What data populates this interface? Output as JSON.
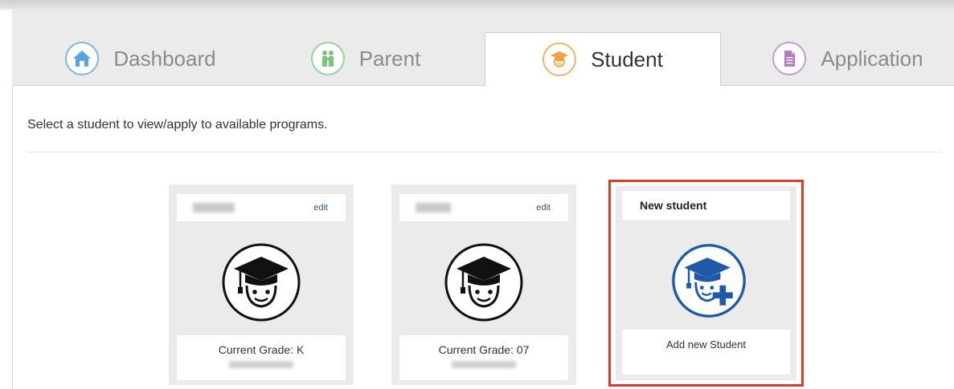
{
  "tabs": [
    {
      "label": "Dashboard",
      "icon": "home-icon",
      "color": "#5aa4e0"
    },
    {
      "label": "Parent",
      "icon": "parent-icon",
      "color": "#7cc47f"
    },
    {
      "label": "Student",
      "icon": "student-icon",
      "color": "#f0a33a",
      "active": true
    },
    {
      "label": "Application",
      "icon": "application-icon",
      "color": "#b17cc0"
    }
  ],
  "instruction": "Select a student to view/apply to available programs.",
  "students": [
    {
      "edit_label": "edit",
      "grade": "Current Grade: K",
      "icon": "graduate-avatar-icon"
    },
    {
      "edit_label": "edit",
      "grade": "Current Grade: 07",
      "icon": "graduate-avatar-icon"
    }
  ],
  "new_student": {
    "title": "New student",
    "action_label": "Add new Student",
    "icon": "add-student-icon",
    "accent_color": "#1f5aa8",
    "highlight_color": "#d63d2a"
  }
}
